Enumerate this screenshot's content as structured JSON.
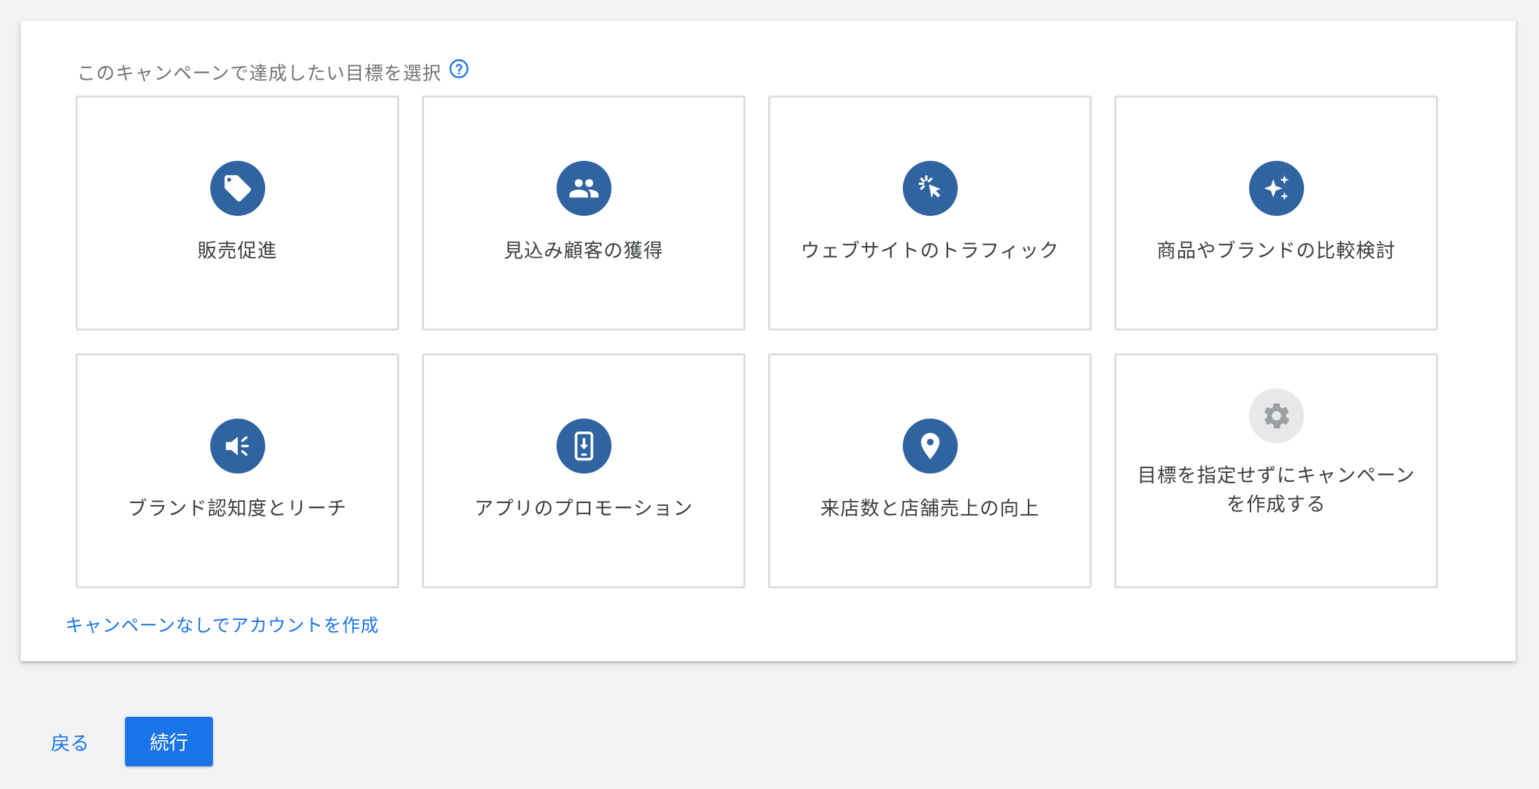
{
  "page": {
    "heading": "このキャンペーンで達成したい目標を選択",
    "help_icon": "help-circle-icon"
  },
  "goals": [
    {
      "label": "販売促進",
      "icon": "tag-icon"
    },
    {
      "label": "見込み顧客の獲得",
      "icon": "people-icon"
    },
    {
      "label": "ウェブサイトのトラフィック",
      "icon": "cursor-click-icon"
    },
    {
      "label": "商品やブランドの比較検討",
      "icon": "sparkle-icon"
    },
    {
      "label": "ブランド認知度とリーチ",
      "icon": "megaphone-icon"
    },
    {
      "label": "アプリのプロモーション",
      "icon": "phone-download-icon"
    },
    {
      "label": "来店数と店舗売上の向上",
      "icon": "location-pin-icon"
    },
    {
      "label": "目標を指定せずにキャンペーンを作成する",
      "icon": "gear-icon"
    }
  ],
  "links": {
    "create_without_campaign": "キャンペーンなしでアカウントを作成"
  },
  "footer": {
    "back_label": "戻る",
    "continue_label": "続行"
  },
  "colors": {
    "icon_bg": "#2f64a0",
    "icon_bg_disabled": "#e8e8ea",
    "primary": "#1a73e8",
    "card_border": "#dadce0"
  }
}
